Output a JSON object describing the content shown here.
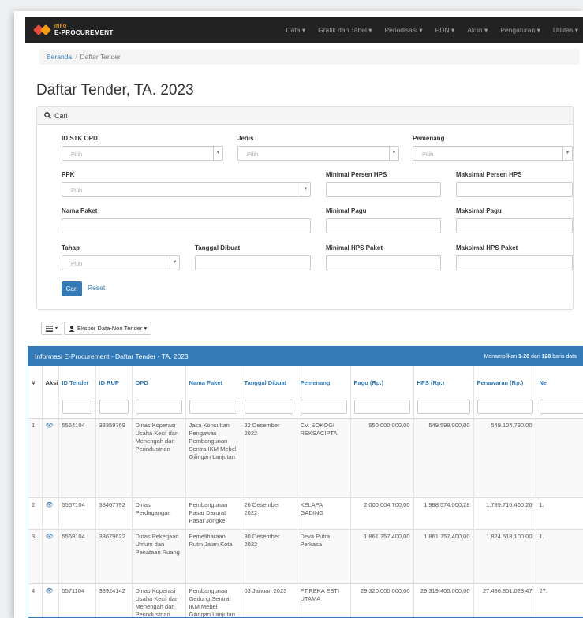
{
  "navbar": {
    "brand_line1": "INFO",
    "brand_line2": "E-PROCUREMENT",
    "menu": [
      "Data ▾",
      "Grafik dan Tabel ▾",
      "Periodisasi ▾",
      "PDN ▾",
      "Akun ▾",
      "Pengaturan ▾",
      "Utilitas ▾"
    ]
  },
  "breadcrumb": {
    "home": "Beranda",
    "separator": "/",
    "current": "Daftar Tender"
  },
  "page_title": "Daftar Tender, TA. 2023",
  "search_panel": {
    "title": "Cari",
    "icon": "search-icon",
    "labels": {
      "id_stk_opd": "ID STK OPD",
      "jenis": "Jenis",
      "pemenang": "Pemenang",
      "ppk": "PPK",
      "min_persen_hps": "Minimal Persen HPS",
      "max_persen_hps": "Maksimal Persen HPS",
      "nama_paket": "Nama Paket",
      "min_pagu": "Minimal Pagu",
      "max_pagu": "Maksimal Pagu",
      "tahap": "Tahap",
      "tanggal_dibuat": "Tanggal Dibuat",
      "min_hps_paket": "Minimal HPS Paket",
      "max_hps_paket": "Maksimal HPS Paket"
    },
    "select_placeholder": "Pilih",
    "submit_label": "Cari",
    "reset_label": "Reset"
  },
  "toolbar": {
    "columns_icon": "list-icon",
    "export_label": "Ekspor Data-Non Tender ▾",
    "export_icon": "user-icon"
  },
  "table": {
    "title": "Informasi E-Procurement - Daftar Tender - TA. 2023",
    "info_prefix": "Menampilkan ",
    "info_range": "1-20",
    "info_mid": " dari ",
    "info_total": "120",
    "info_suffix": " baris data",
    "headers": [
      "#",
      "Aksi",
      "ID Tender",
      "ID RUP",
      "OPD",
      "Nama Paket",
      "Tanggal Dibuat",
      "Pemenang",
      "Pagu (Rp.)",
      "HPS (Rp.)",
      "Penawaran (Rp.)",
      "Ne"
    ],
    "rows": [
      {
        "no": "1",
        "id_tender": "5564104",
        "id_rup": "38359769",
        "opd": "Dinas Koperasi Usaha Kecil dan Menengah dan Perindustrian",
        "paket": "Jasa Konsultan Pengawas Pembangunan Sentra IKM Mebel Gilingan Lanjutan",
        "tanggal": "22 Desember 2022",
        "pemenang": "CV. SOKOGI REKSACIPTA",
        "pagu": "550.000.000,00",
        "hps": "549.598.000,00",
        "penawaran": "549.104.790,00",
        "ne": ""
      },
      {
        "no": "2",
        "id_tender": "5567104",
        "id_rup": "38467792",
        "opd": "Dinas Perdagangan",
        "paket": "Pembangunan Pasar Darurat Pasar Jongke",
        "tanggal": "26 Desember 2022",
        "pemenang": "KELAPA GADING",
        "pagu": "2.000.004.700,00",
        "hps": "1.988.574.000,28",
        "penawaran": "1.789.716.460,26",
        "ne": "1."
      },
      {
        "no": "3",
        "id_tender": "5569104",
        "id_rup": "38679622",
        "opd": "Dinas Pekerjaan Umum dan Penataan Ruang",
        "paket": "Pemeliharaan Rutin Jalan Kota",
        "tanggal": "30 Desember 2022",
        "pemenang": "Deva Putra Perkasa",
        "pagu": "1.861.757.400,00",
        "hps": "1.861.757.400,00",
        "penawaran": "1.824.518.100,00",
        "ne": "1."
      },
      {
        "no": "4",
        "id_tender": "5571104",
        "id_rup": "38924142",
        "opd": "Dinas Koperasi Usaha Kecil dan Menengah dan Perindustrian",
        "paket": "Pembangunan Gedung Sentra IKM Mebel Gilingan Lanjutan",
        "tanggal": "03 Januari 2023",
        "pemenang": "PT.REKA ESTI UTAMA",
        "pagu": "29.320.000.000,00",
        "hps": "29.319.400.000,00",
        "penawaran": "27.486.851.023,47",
        "ne": "27."
      }
    ]
  }
}
